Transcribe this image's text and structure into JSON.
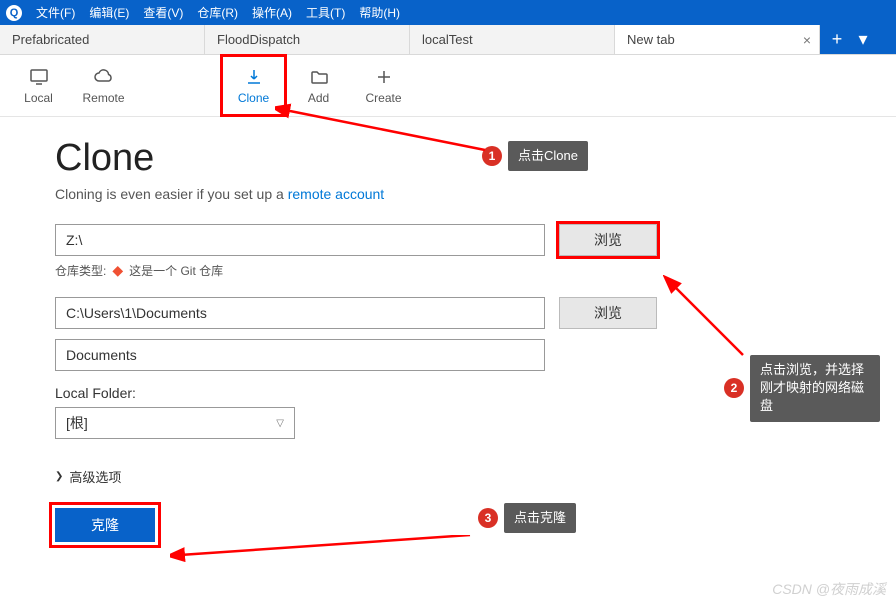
{
  "menu": {
    "items": [
      "文件(F)",
      "编辑(E)",
      "查看(V)",
      "仓库(R)",
      "操作(A)",
      "工具(T)",
      "帮助(H)"
    ]
  },
  "tabs": {
    "items": [
      "Prefabricated",
      "FloodDispatch",
      "localTest",
      "New tab"
    ],
    "close": "×",
    "plus": "+",
    "caret": "▾"
  },
  "toolbar": {
    "local": "Local",
    "remote": "Remote",
    "clone": "Clone",
    "add": "Add",
    "create": "Create"
  },
  "page": {
    "title": "Clone",
    "subtitle_pre": "Cloning is even easier if you set up a ",
    "subtitle_link": "remote account",
    "source": "Z:\\",
    "browse1": "浏览",
    "repo_type_label": "仓库类型:",
    "repo_type_value": "这是一个 Git 仓库",
    "dest": "C:\\Users\\1\\Documents",
    "browse2": "浏览",
    "name": "Documents",
    "local_folder_label": "Local Folder:",
    "local_folder_value": "[根]",
    "advanced": "高级选项",
    "submit": "克隆"
  },
  "annotations": {
    "a1": "点击Clone",
    "a2": "点击浏览，并选择刚才映射的网络磁盘",
    "a3": "点击克隆"
  },
  "watermark": "CSDN @夜雨成溪"
}
